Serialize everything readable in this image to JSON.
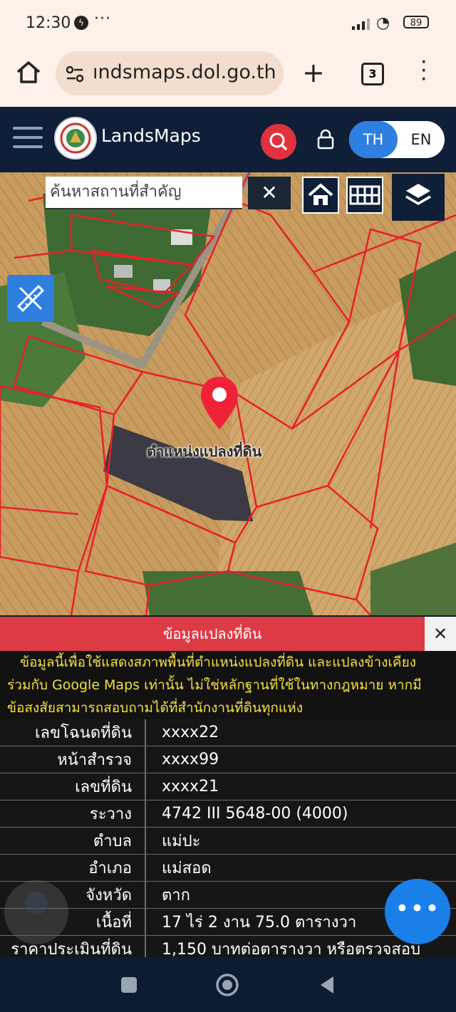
{
  "status_bar": {
    "time": "12:30",
    "battery": "89"
  },
  "browser": {
    "url": "ındsmaps.dol.go.th",
    "tab_count": "3"
  },
  "app": {
    "title": "LandsMaps",
    "lang_th": "TH",
    "lang_en": "EN"
  },
  "map": {
    "search_placeholder": "ค้นหาสถานที่สำคัญ",
    "clear_label": "✕",
    "pin_label": "ตำแหน่งแปลงที่ดิน"
  },
  "panel": {
    "header": "ข้อมูลแปลงที่ดิน",
    "close_label": "✕",
    "notice_lines": [
      "ข้อมูลนี้เพื่อใช้แสดงสภาพพื้นที่ตำแหน่งแปลงที่ดิน และแปลงข้างเคียง",
      "ร่วมกับ Google Maps เท่านั้น ไม่ใช่หลักฐานที่ใช้ในทางกฎหมาย หากมี",
      "ข้อสงสัยสามารถสอบถามได้ที่สำนักงานที่ดินทุกแห่ง"
    ],
    "rows": [
      {
        "label": "เลขโฉนดที่ดิน",
        "value": "xxxx22"
      },
      {
        "label": "หน้าสำรวจ",
        "value": "xxxx99"
      },
      {
        "label": "เลขที่ดิน",
        "value": "xxxx21"
      },
      {
        "label": "ระวาง",
        "value": "4742 III 5648-00 (4000)"
      },
      {
        "label": "ตำบล",
        "value": "แม่ปะ"
      },
      {
        "label": "อำเภอ",
        "value": "แม่สอด"
      },
      {
        "label": "จังหวัด",
        "value": "ตาก"
      },
      {
        "label": "เนื้อที่",
        "value": "17 ไร่ 2 งาน 75.0 ตารางวา"
      },
      {
        "label": "ราคาประเมินที่ดิน",
        "value": "1,150 บาทต่อตารางวา หรือตรวจสอบ"
      }
    ]
  },
  "fab": {
    "label": "•••"
  },
  "icons": [
    "home-icon",
    "tune-icon",
    "plus-icon",
    "tabs-icon",
    "kebab-menu-icon",
    "hamburger-icon",
    "search-icon",
    "lock-icon",
    "map-home-icon",
    "grid-icon",
    "layers-icon",
    "ruler-pencil-icon",
    "location-pin-icon",
    "info-icon",
    "square-nav-icon",
    "circle-nav-icon",
    "back-nav-icon"
  ],
  "colors": {
    "brand_dark": "#0f1f38",
    "accent_blue": "#2e7fe0",
    "accent_red": "#dc3b46",
    "notice_yellow": "#f5e042",
    "parcel_line": "#e8202a"
  }
}
